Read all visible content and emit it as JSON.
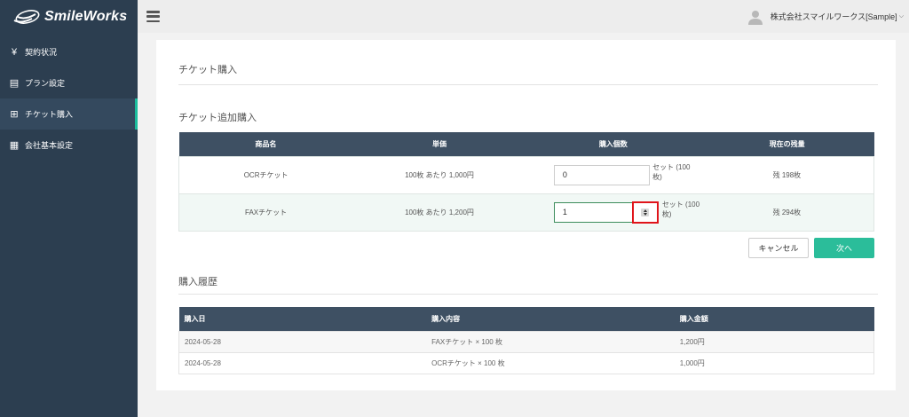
{
  "brand": {
    "name": "SmileWorks"
  },
  "sidebar": {
    "items": [
      {
        "icon": "yen-icon",
        "glyph": "¥",
        "label": "契約状況",
        "active": false
      },
      {
        "icon": "card-icon",
        "glyph": "▤",
        "label": "プラン設定",
        "active": false
      },
      {
        "icon": "plus-square-icon",
        "glyph": "⊞",
        "label": "チケット購入",
        "active": true
      },
      {
        "icon": "building-icon",
        "glyph": "▦",
        "label": "会社基本設定",
        "active": false
      }
    ]
  },
  "topbar": {
    "user_name": "株式会社スマイルワークス[Sample]"
  },
  "page": {
    "title": "チケット購入",
    "add_section_title": "チケット追加購入",
    "purchase_table": {
      "headers": [
        "商品名",
        "単価",
        "購入個数",
        "現在の残量"
      ],
      "rows": [
        {
          "name": "OCRチケット",
          "price": "100枚 あたり 1,000円",
          "qty": "0",
          "unit": "セット (100 枚)",
          "remaining": "残 198枚"
        },
        {
          "name": "FAXチケット",
          "price": "100枚 あたり 1,200円",
          "qty": "1",
          "unit": "セット (100 枚)",
          "remaining": "残 294枚"
        }
      ]
    },
    "buttons": {
      "cancel": "キャンセル",
      "next": "次へ"
    },
    "history_title": "購入履歴",
    "history_table": {
      "headers": [
        "購入日",
        "購入内容",
        "購入金額"
      ],
      "rows": [
        {
          "date": "2024-05-28",
          "content": "FAXチケット × 100 枚",
          "amount": "1,200円"
        },
        {
          "date": "2024-05-28",
          "content": "OCRチケット × 100 枚",
          "amount": "1,000円"
        }
      ]
    }
  },
  "colors": {
    "sidebar_bg": "#2c3e50",
    "active_accent": "#1abc9c",
    "table_header": "#3e5063",
    "next_button": "#2bbd9a",
    "highlight_box": "#e0141a"
  }
}
